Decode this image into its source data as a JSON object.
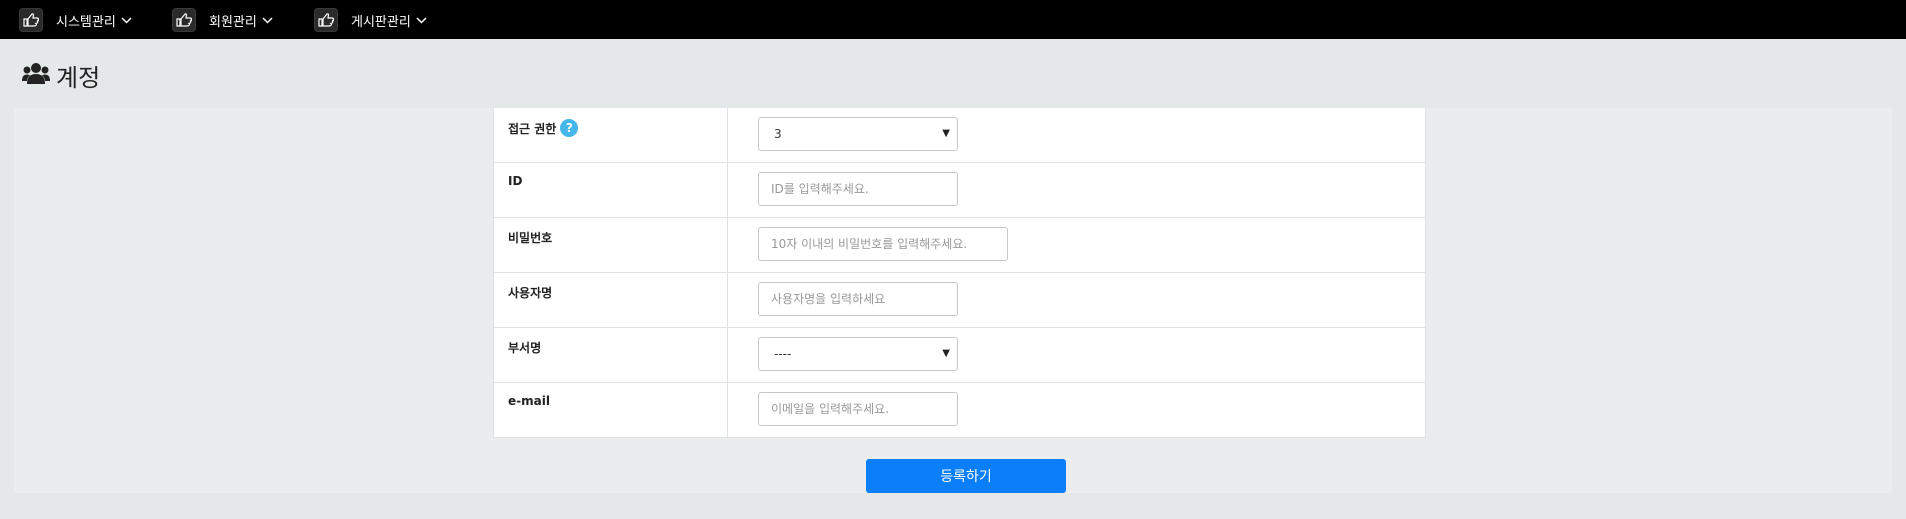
{
  "nav": {
    "items": [
      {
        "label": "시스템관리",
        "icon": "hand-pointer-icon"
      },
      {
        "label": "회원관리",
        "icon": "hand-pointer-icon"
      },
      {
        "label": "게시판관리",
        "icon": "hand-pointer-icon"
      }
    ]
  },
  "page": {
    "title": "계정",
    "title_icon": "users-icon"
  },
  "form": {
    "access_level": {
      "label": "접근 권한",
      "help": "?",
      "value": "3"
    },
    "id": {
      "label": "ID",
      "placeholder": "ID를 입력해주세요."
    },
    "password": {
      "label": "비밀번호",
      "placeholder": "10자 이내의 비밀번호를 입력해주세요."
    },
    "username": {
      "label": "사용자명",
      "placeholder": "사용자명을 입력하세요"
    },
    "department": {
      "label": "부서명",
      "value": "----"
    },
    "email": {
      "label": "e-mail",
      "placeholder": "이메일을 입력해주세요."
    }
  },
  "actions": {
    "submit_label": "등록하기"
  },
  "colors": {
    "nav_bg": "#000000",
    "page_bg": "#e5e8e9",
    "accent": "#0b7ef9",
    "help_icon": "#45b7ea"
  }
}
